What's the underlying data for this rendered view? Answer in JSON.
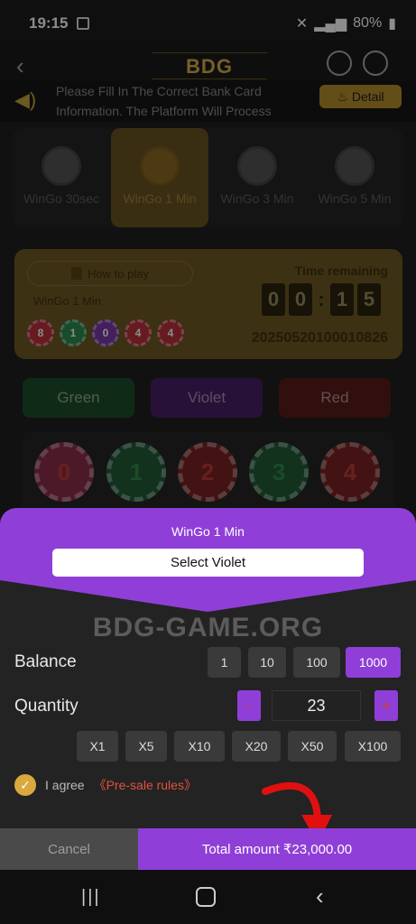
{
  "statusbar": {
    "time": "19:15",
    "battery": "80%"
  },
  "header": {
    "logo_text": "BDG GAME"
  },
  "notice": {
    "text": "Please Fill In The Correct Bank Card Information. The Platform Will Process Withdrawa",
    "detail_label": "Detail"
  },
  "game_tabs": [
    {
      "label": "WinGo 30sec"
    },
    {
      "label": "WinGo 1 Min"
    },
    {
      "label": "WinGo 3 Min"
    },
    {
      "label": "WinGo 5 Min"
    }
  ],
  "timecard": {
    "how_to_play": "How to play",
    "game_name": "WinGo 1 Min",
    "results": [
      "8",
      "1",
      "0",
      "4",
      "4"
    ],
    "time_label": "Time remaining",
    "timer": [
      "0",
      "0",
      "1",
      "5"
    ],
    "issue": "20250520100010826"
  },
  "color_buttons": {
    "green": "Green",
    "violet": "Violet",
    "red": "Red"
  },
  "numbers": [
    "0",
    "1",
    "2",
    "3",
    "4"
  ],
  "sheet": {
    "title": "WinGo 1 Min",
    "selection": "Select Violet",
    "watermark": "BDG-GAME.ORG",
    "balance_label": "Balance",
    "balance_options": [
      "1",
      "10",
      "100",
      "1000"
    ],
    "balance_selected": "1000",
    "quantity_label": "Quantity",
    "quantity_minus": "-",
    "quantity_value": "23",
    "quantity_plus": "+",
    "multipliers": [
      "X1",
      "X5",
      "X10",
      "X20",
      "X50",
      "X100"
    ],
    "agree_text": "I agree",
    "rules_link": "《Pre-sale rules》",
    "cancel_label": "Cancel",
    "total_label": "Total amount ₹23,000.00"
  },
  "colors": {
    "accent": "#8f3fd8",
    "gold": "#d9a93d",
    "green": "#1c4f2d",
    "red": "#5a1c1c"
  }
}
